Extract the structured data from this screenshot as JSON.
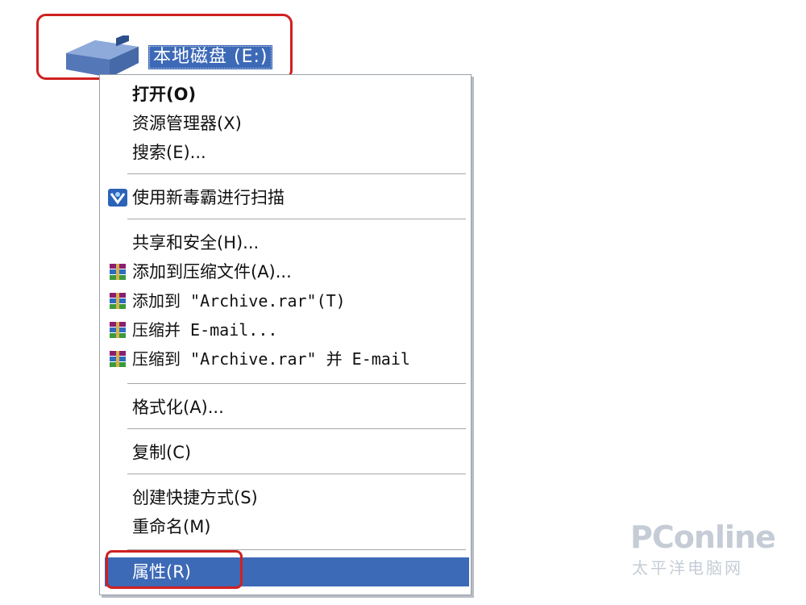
{
  "drive": {
    "label": "本地磁盘 (E:)",
    "icon": "hard-drive-icon"
  },
  "menu": {
    "items": [
      {
        "label": "打开(O)",
        "bold": true
      },
      {
        "label": "资源管理器(X)"
      },
      {
        "label": "搜索(E)..."
      },
      {
        "label": "使用新毒霸进行扫描",
        "icon": "antivirus-scan-icon"
      },
      {
        "label": "共享和安全(H)..."
      },
      {
        "label": "添加到压缩文件(A)...",
        "icon": "winrar-icon"
      },
      {
        "label": "添加到 \"Archive.rar\"(T)",
        "icon": "winrar-icon"
      },
      {
        "label": "压缩并 E-mail...",
        "icon": "winrar-icon"
      },
      {
        "label": "压缩到 \"Archive.rar\" 并 E-mail",
        "icon": "winrar-icon"
      },
      {
        "label": "格式化(A)..."
      },
      {
        "label": "复制(C)"
      },
      {
        "label": "创建快捷方式(S)"
      },
      {
        "label": "重命名(M)"
      },
      {
        "label": "属性(R)",
        "selected": true
      }
    ]
  },
  "watermark": {
    "logo": "PConline",
    "sub": "太平洋电脑网"
  },
  "colors": {
    "selection": "#3d6ab7",
    "highlight_box": "#d02020"
  }
}
